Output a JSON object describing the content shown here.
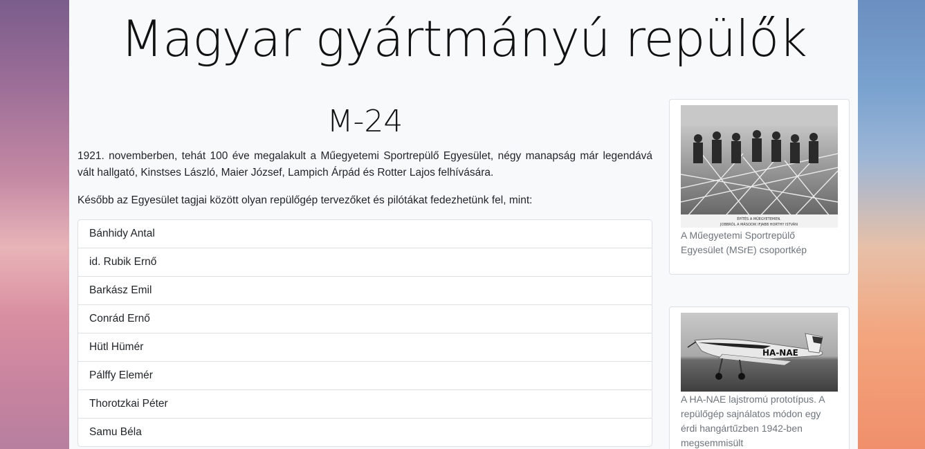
{
  "page": {
    "title": "Magyar gyártmányú repülők"
  },
  "section": {
    "title": "M-24",
    "paragraph1": "1921. novemberben, tehát 100 éve megalakult a Műegyetemi Sportrepülő Egyesület, négy manapság már legendává vált hallgató, Kinstses László, Maier József, Lampich Árpád és Rotter Lajos felhívására.",
    "paragraph2": "Később az Egyesület tagjai között olyan repülőgép tervezőket és pilótákat fedezhetünk fel, mint:",
    "people": [
      "Bánhidy Antal",
      "id. Rubik Ernő",
      "Barkász Emil",
      "Conrád Ernő",
      "Hütl Hümér",
      "Pálffy Elemér",
      "Thorotzkai Péter",
      "Samu Béla"
    ]
  },
  "cards": [
    {
      "photo_caption_text": "ÉPÍTÉS A MŰEGYETEMEN. JOBBRÓL A MÁSODIK IFJABB HORTHY ISTVÁN",
      "caption": "A Műegyetemi Sportrepülő Egyesület (MSrE) csoportkép"
    },
    {
      "plane_registration": "HA-NAE",
      "caption": "A HA-NAE lajstromú prototípus. A repülőgép sajnálatos módon egy érdi hangártűzben 1942-ben megsemmisült"
    }
  ],
  "colors": {
    "container_bg": "#f8f9fa",
    "text": "#212529",
    "caption": "#6c757d",
    "border": "#dcdfe3"
  }
}
